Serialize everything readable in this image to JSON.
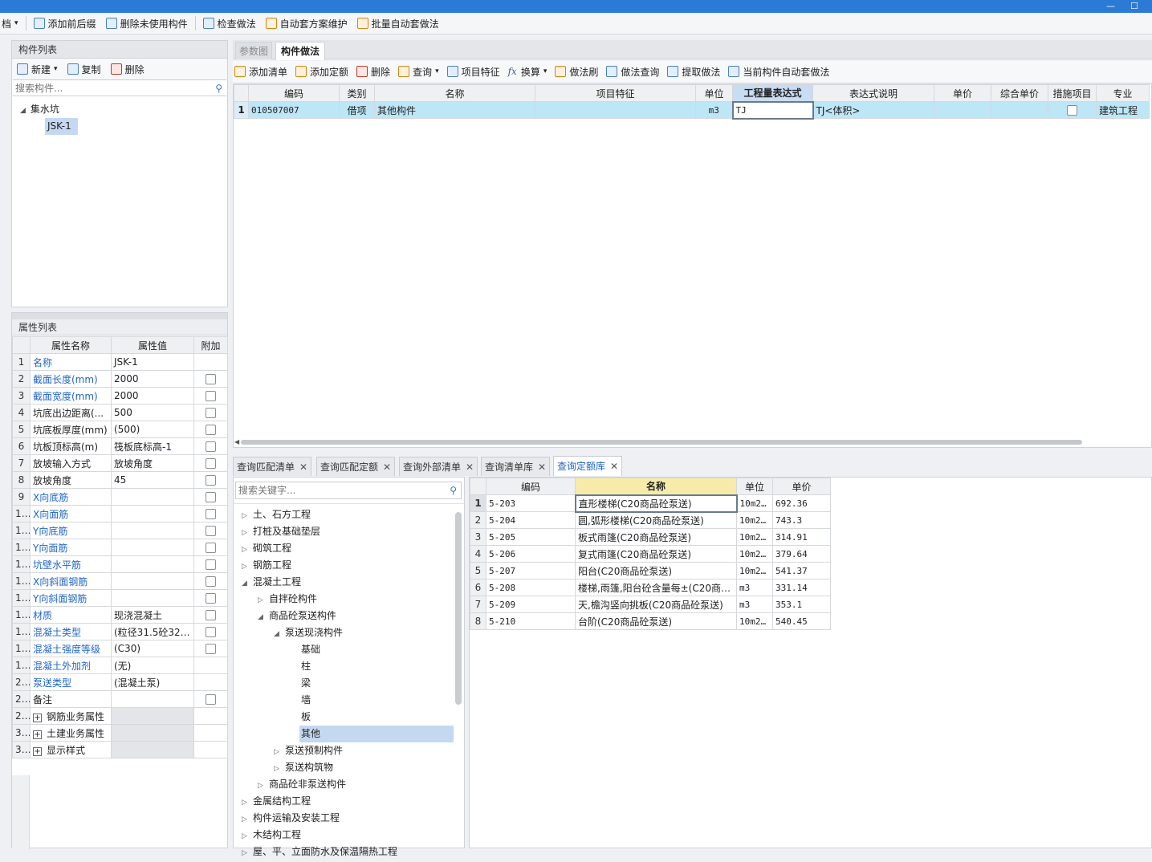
{
  "toolbar": {
    "partial_left": "档",
    "items": [
      "添加前后缀",
      "删除未使用构件",
      "检查做法",
      "自动套方案维护",
      "批量自动套做法"
    ]
  },
  "component_list": {
    "header": "构件列表",
    "new_label": "新建",
    "copy_label": "复制",
    "delete_label": "删除",
    "search_placeholder": "搜索构件...",
    "tree_root": "集水坑",
    "tree_child": "JSK-1"
  },
  "properties": {
    "header": "属性列表",
    "columns": [
      "属性名称",
      "属性值",
      "附加"
    ],
    "rows": [
      {
        "n": "1",
        "name": "名称",
        "value": "JSK-1",
        "blue": true,
        "chk": false
      },
      {
        "n": "2",
        "name": "截面长度(mm)",
        "value": "2000",
        "blue": true,
        "chk": true
      },
      {
        "n": "3",
        "name": "截面宽度(mm)",
        "value": "2000",
        "blue": true,
        "chk": true
      },
      {
        "n": "4",
        "name": "坑底出边距离(...",
        "value": "500",
        "blue": false,
        "chk": true
      },
      {
        "n": "5",
        "name": "坑底板厚度(mm)",
        "value": "(500)",
        "blue": false,
        "chk": true
      },
      {
        "n": "6",
        "name": "坑板顶标高(m)",
        "value": "筏板底标高-1",
        "blue": false,
        "chk": true
      },
      {
        "n": "7",
        "name": "放坡输入方式",
        "value": "放坡角度",
        "blue": false,
        "chk": true
      },
      {
        "n": "8",
        "name": "放坡角度",
        "value": "45",
        "blue": false,
        "chk": true
      },
      {
        "n": "9",
        "name": "X向底筋",
        "value": "",
        "blue": true,
        "chk": true
      },
      {
        "n": "10",
        "name": "X向面筋",
        "value": "",
        "blue": true,
        "chk": true
      },
      {
        "n": "11",
        "name": "Y向底筋",
        "value": "",
        "blue": true,
        "chk": true
      },
      {
        "n": "12",
        "name": "Y向面筋",
        "value": "",
        "blue": true,
        "chk": true
      },
      {
        "n": "13",
        "name": "坑壁水平筋",
        "value": "",
        "blue": true,
        "chk": true
      },
      {
        "n": "14",
        "name": "X向斜面钢筋",
        "value": "",
        "blue": true,
        "chk": true
      },
      {
        "n": "15",
        "name": "Y向斜面钢筋",
        "value": "",
        "blue": true,
        "chk": true
      },
      {
        "n": "16",
        "name": "材质",
        "value": "现浇混凝土",
        "blue": true,
        "chk": true
      },
      {
        "n": "17",
        "name": "混凝土类型",
        "value": "(粒径31.5砼32....",
        "blue": true,
        "chk": true
      },
      {
        "n": "18",
        "name": "混凝土强度等级",
        "value": "(C30)",
        "blue": true,
        "chk": true
      },
      {
        "n": "19",
        "name": "混凝土外加剂",
        "value": "(无)",
        "blue": true,
        "chk": false
      },
      {
        "n": "20",
        "name": "泵送类型",
        "value": "(混凝土泵)",
        "blue": true,
        "chk": false
      },
      {
        "n": "21",
        "name": "备注",
        "value": "",
        "blue": false,
        "chk": true
      },
      {
        "n": "22",
        "name": "钢筋业务属性",
        "value": "",
        "blue": false,
        "chk": false,
        "group": true
      },
      {
        "n": "33",
        "name": "土建业务属性",
        "value": "",
        "blue": false,
        "chk": false,
        "group": true
      },
      {
        "n": "35",
        "name": "显示样式",
        "value": "",
        "blue": false,
        "chk": false,
        "group": true
      }
    ]
  },
  "top_tabs": [
    "参数图",
    "构件做法"
  ],
  "method_toolbar": [
    "添加清单",
    "添加定额",
    "删除",
    "查询",
    "项目特征",
    "换算",
    "做法刷",
    "做法查询",
    "提取做法",
    "当前构件自动套做法"
  ],
  "method_table": {
    "columns": [
      "编码",
      "类别",
      "名称",
      "项目特征",
      "单位",
      "工程量表达式",
      "表达式说明",
      "单价",
      "综合单价",
      "措施项目",
      "专业"
    ],
    "row": {
      "n": "1",
      "code": "010507007",
      "category": "借项",
      "name": "其他构件",
      "feature": "",
      "unit": "m3",
      "expr": "TJ",
      "expr_desc": "TJ<体积>",
      "price": "",
      "total_price": "",
      "specialty": "建筑工程"
    }
  },
  "bottom_tabs": [
    "查询匹配清单",
    "查询匹配定额",
    "查询外部清单",
    "查询清单库",
    "查询定额库"
  ],
  "keyword_placeholder": "搜索关键字...",
  "library_tree": [
    {
      "label": "土、石方工程",
      "level": 0,
      "state": "closed"
    },
    {
      "label": "打桩及基础垫层",
      "level": 0,
      "state": "closed"
    },
    {
      "label": "砌筑工程",
      "level": 0,
      "state": "closed"
    },
    {
      "label": "钢筋工程",
      "level": 0,
      "state": "closed"
    },
    {
      "label": "混凝土工程",
      "level": 0,
      "state": "open"
    },
    {
      "label": "自拌砼构件",
      "level": 1,
      "state": "closed"
    },
    {
      "label": "商品砼泵送构件",
      "level": 1,
      "state": "open"
    },
    {
      "label": "泵送现浇构件",
      "level": 2,
      "state": "open"
    },
    {
      "label": "基础",
      "level": 3,
      "state": "leaf"
    },
    {
      "label": "柱",
      "level": 3,
      "state": "leaf"
    },
    {
      "label": "梁",
      "level": 3,
      "state": "leaf"
    },
    {
      "label": "墙",
      "level": 3,
      "state": "leaf"
    },
    {
      "label": "板",
      "level": 3,
      "state": "leaf"
    },
    {
      "label": "其他",
      "level": 3,
      "state": "leaf",
      "selected": true
    },
    {
      "label": "泵送预制构件",
      "level": 2,
      "state": "closed"
    },
    {
      "label": "泵送构筑物",
      "level": 2,
      "state": "closed"
    },
    {
      "label": "商品砼非泵送构件",
      "level": 1,
      "state": "closed"
    },
    {
      "label": "金属结构工程",
      "level": 0,
      "state": "closed"
    },
    {
      "label": "构件运输及安装工程",
      "level": 0,
      "state": "closed"
    },
    {
      "label": "木结构工程",
      "level": 0,
      "state": "closed"
    },
    {
      "label": "屋、平、立面防水及保温隔热工程",
      "level": 0,
      "state": "closed"
    }
  ],
  "quota_table": {
    "columns": [
      "编码",
      "名称",
      "单位",
      "单价"
    ],
    "rows": [
      {
        "n": "1",
        "code": "5-203",
        "name": "直形楼梯(C20商品砼泵送)",
        "unit": "10m2…",
        "price": "692.36"
      },
      {
        "n": "2",
        "code": "5-204",
        "name": "圆,弧形楼梯(C20商品砼泵送)",
        "unit": "10m2…",
        "price": "743.3"
      },
      {
        "n": "3",
        "code": "5-205",
        "name": "板式雨篷(C20商品砼泵送)",
        "unit": "10m2…",
        "price": "314.91"
      },
      {
        "n": "4",
        "code": "5-206",
        "name": "复式雨篷(C20商品砼泵送)",
        "unit": "10m2…",
        "price": "379.64"
      },
      {
        "n": "5",
        "code": "5-207",
        "name": "阳台(C20商品砼泵送)",
        "unit": "10m2…",
        "price": "541.37"
      },
      {
        "n": "6",
        "code": "5-208",
        "name": "楼梯,雨篷,阳台砼含量每±(C20商…",
        "unit": "m3",
        "price": "331.14"
      },
      {
        "n": "7",
        "code": "5-209",
        "name": "天,檐沟竖向挑板(C20商品砼泵送)",
        "unit": "m3",
        "price": "353.1"
      },
      {
        "n": "8",
        "code": "5-210",
        "name": "台阶(C20商品砼泵送)",
        "unit": "10m2…",
        "price": "540.45"
      }
    ]
  },
  "colors": {
    "titlebar": "#2b7ad6",
    "selected_row": "#bde6f7",
    "link_blue": "#1e64c8",
    "tree_selected": "#c5d8f1"
  }
}
